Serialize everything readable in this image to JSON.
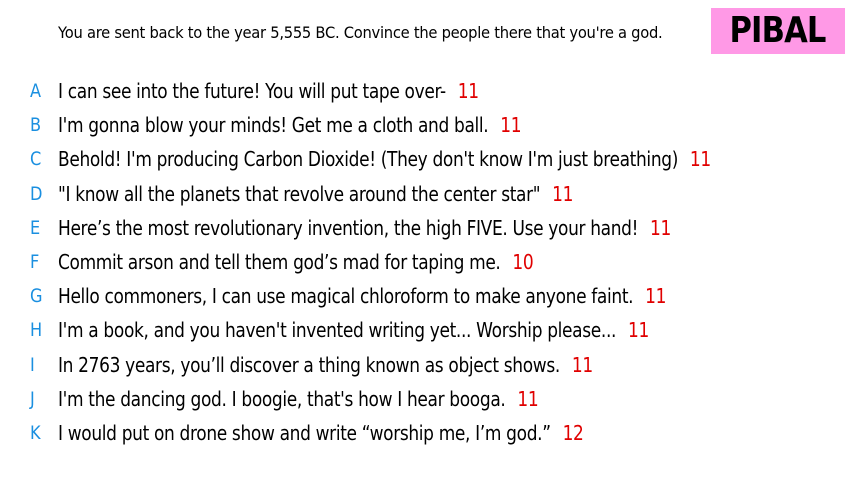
{
  "prompt": "You are sent back to the year 5,555 BC. Convince the people there that you're a god.",
  "player_name": "PIBAL",
  "colors": {
    "letter": "#1a8fe0",
    "score": "#e00000",
    "badge_bg": "#ff99e6"
  },
  "answers": [
    {
      "letter": "A",
      "text": "I can see into the future! You will put tape over-",
      "score": "11"
    },
    {
      "letter": "B",
      "text": "I'm gonna blow your minds! Get me a cloth and ball.",
      "score": "11"
    },
    {
      "letter": "C",
      "text": "Behold! I'm producing Carbon Dioxide! (They don't know I'm just breathing)",
      "score": "11"
    },
    {
      "letter": "D",
      "text": "\"I know all the planets that revolve around the center star\"",
      "score": "11"
    },
    {
      "letter": "E",
      "text": "Here’s the most revolutionary invention, the high FIVE. Use your hand!",
      "score": "11"
    },
    {
      "letter": "F",
      "text": "Commit arson and tell them god’s mad for taping me.",
      "score": "10"
    },
    {
      "letter": "G",
      "text": "Hello commoners, I can use magical chloroform to make anyone faint.",
      "score": "11"
    },
    {
      "letter": "H",
      "text": "I'm a book, and you haven't invented writing yet... Worship please...",
      "score": "11"
    },
    {
      "letter": "I",
      "text": "In 2763 years, you’ll discover a thing known as object shows.",
      "score": "11"
    },
    {
      "letter": "J",
      "text": "I'm the dancing god. I boogie, that's how I hear booga.",
      "score": "11"
    },
    {
      "letter": "K",
      "text": "I would put on drone show and write “worship me, I’m god.”",
      "score": "12"
    }
  ]
}
